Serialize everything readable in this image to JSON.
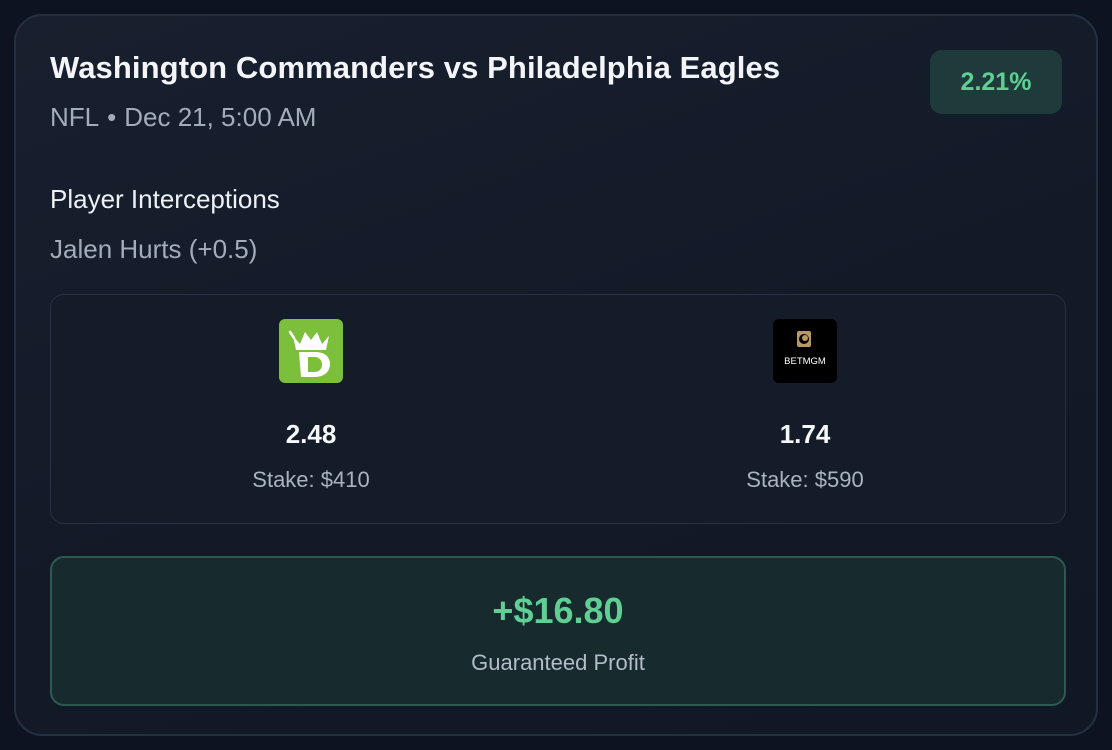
{
  "event": {
    "title": "Washington Commanders vs Philadelphia Eagles",
    "league": "NFL",
    "separator": "•",
    "datetime": "Dec 21, 5:00 AM"
  },
  "badge": {
    "percent": "2.21%"
  },
  "market": {
    "name": "Player Interceptions",
    "selection": "Jalen Hurts (+0.5)"
  },
  "books": [
    {
      "icon": "draftkings-logo-icon",
      "odds": "2.48",
      "stake": "Stake: $410"
    },
    {
      "icon": "betmgm-logo-icon",
      "logo_text": "BETMGM",
      "odds": "1.74",
      "stake": "Stake: $590"
    }
  ],
  "profit": {
    "amount": "+$16.80",
    "label": "Guaranteed Profit"
  },
  "colors": {
    "accent_green": "#5fcf93",
    "draftkings_green": "#7cbf3a",
    "card_background": "#18202f"
  }
}
